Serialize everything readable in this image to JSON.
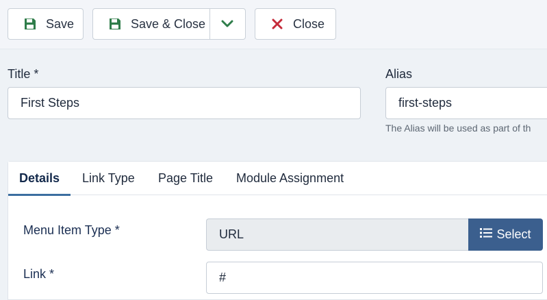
{
  "toolbar": {
    "save_label": "Save",
    "save_close_label": "Save & Close",
    "close_label": "Close"
  },
  "form": {
    "title_label": "Title *",
    "title_value": "First Steps",
    "alias_label": "Alias",
    "alias_value": "first-steps",
    "alias_hint": "The Alias will be used as part of th"
  },
  "tabs": [
    {
      "label": "Details",
      "active": true
    },
    {
      "label": "Link Type",
      "active": false
    },
    {
      "label": "Page Title",
      "active": false
    },
    {
      "label": "Module Assignment",
      "active": false
    }
  ],
  "details": {
    "menu_item_type_label": "Menu Item Type *",
    "menu_item_type_value": "URL",
    "select_label": "Select",
    "link_label": "Link *",
    "link_value": "#"
  },
  "colors": {
    "save_icon": "#2f7d4a",
    "close_icon": "#c52b3a",
    "select_button": "#3b5f8e",
    "active_tab_underline": "#3b6ea0"
  },
  "icons": {
    "save": "floppy-disk-icon",
    "dropdown": "chevron-down-icon",
    "close": "x-icon",
    "select": "list-icon"
  }
}
